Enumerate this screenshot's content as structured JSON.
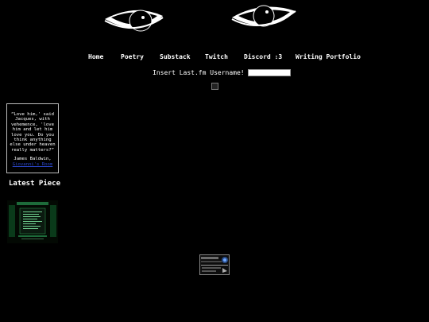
{
  "nav": {
    "items": [
      {
        "label": "Home"
      },
      {
        "label": "Poetry"
      },
      {
        "label": "Substack"
      },
      {
        "label": "Twitch"
      },
      {
        "label": "Discord :3"
      },
      {
        "label": "Writing Portfolio"
      }
    ]
  },
  "lastfm": {
    "label": "Insert Last.fm Username!",
    "value": ""
  },
  "quote": {
    "text": "“Love him,' said Jacques, with vehemence, 'love him and let him love you. Do you think anything else under heaven really matters?”",
    "author": "James Baldwin,",
    "source": "Giovanni's Room"
  },
  "latest": {
    "title": "Latest Piece"
  },
  "colors": {
    "background": "#000000",
    "text": "#ffffff",
    "link": "#2b46c9"
  }
}
